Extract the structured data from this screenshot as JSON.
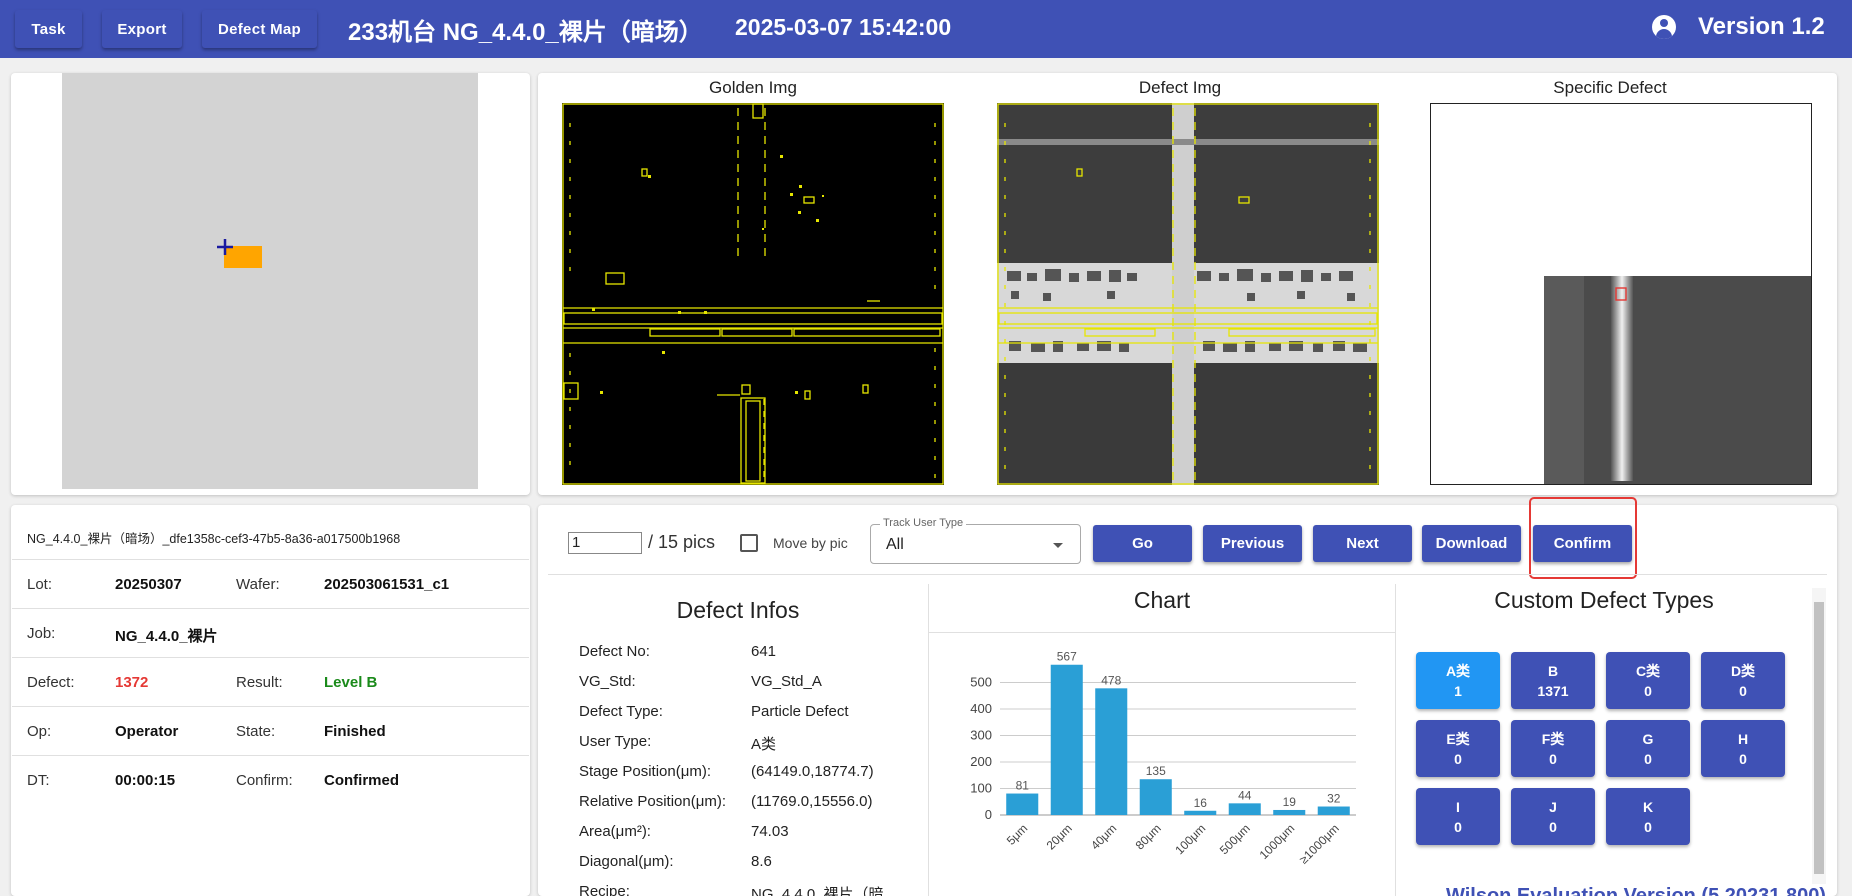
{
  "topbar": {
    "task_label": "Task",
    "export_label": "Export",
    "defect_map_label": "Defect Map",
    "title": "233机台   NG_4.4.0_裸片（暗场）",
    "datetime": "2025-03-07 15:42:00",
    "version": "Version 1.2"
  },
  "images": {
    "golden_title": "Golden Img",
    "defect_title": "Defect Img",
    "specific_title": "Specific Defect"
  },
  "info": {
    "header": "NG_4.4.0_裸片（暗场）_dfe1358c-cef3-47b5-8a36-a017500b1968",
    "lot_label": "Lot:",
    "lot_value": "20250307",
    "wafer_label": "Wafer:",
    "wafer_value": "202503061531_c1",
    "job_label": "Job:",
    "job_value": "NG_4.4.0_裸片",
    "defect_label": "Defect:",
    "defect_value": "1372",
    "result_label": "Result:",
    "result_value": "Level B",
    "op_label": "Op:",
    "op_value": "Operator",
    "state_label": "State:",
    "state_value": "Finished",
    "dt_label": "DT:",
    "dt_value": "00:00:15",
    "confirm_label": "Confirm:",
    "confirm_value": "Confirmed"
  },
  "controls": {
    "page_value": "1",
    "pics_label": "/ 15 pics",
    "move_by_pic_label": "Move by pic",
    "move_by_pic_checked": false,
    "track_user_type_label": "Track User Type",
    "track_user_type_value": "All",
    "go_label": "Go",
    "previous_label": "Previous",
    "next_label": "Next",
    "download_label": "Download",
    "confirm_label": "Confirm"
  },
  "defect_infos": {
    "title": "Defect Infos",
    "rows": [
      {
        "k": "Defect No:",
        "v": "641"
      },
      {
        "k": "VG_Std:",
        "v": "VG_Std_A"
      },
      {
        "k": "Defect Type:",
        "v": "Particle Defect"
      },
      {
        "k": "User Type:",
        "v": "A类"
      },
      {
        "k": "Stage Position(μm):",
        "v": "(64149.0,18774.7)"
      },
      {
        "k": "Relative Position(μm):",
        "v": "(11769.0,15556.0)"
      },
      {
        "k": "Area(μm²):",
        "v": "74.03"
      },
      {
        "k": "Diagonal(μm):",
        "v": "8.6"
      },
      {
        "k": "Recipe:",
        "v": "NG_4.4.0_裸片（暗"
      }
    ]
  },
  "chart_title": "Chart",
  "chart_data": {
    "type": "bar",
    "categories": [
      "5μm",
      "20μm",
      "40μm",
      "80μm",
      "100μm",
      "500μm",
      "1000μm",
      "≥1000μm"
    ],
    "values": [
      81,
      567,
      478,
      135,
      16,
      44,
      19,
      32
    ],
    "ylim": [
      0,
      600
    ],
    "yticks": [
      0,
      100,
      200,
      300,
      400,
      500
    ],
    "grid": true,
    "bar_color": "#2a9fd6"
  },
  "custom_defect_types": {
    "title": "Custom Defect Types",
    "items": [
      {
        "name": "A类",
        "count": "1",
        "active": true
      },
      {
        "name": "B",
        "count": "1371",
        "active": false
      },
      {
        "name": "C类",
        "count": "0",
        "active": false
      },
      {
        "name": "D类",
        "count": "0",
        "active": false
      },
      {
        "name": "E类",
        "count": "0",
        "active": false
      },
      {
        "name": "F类",
        "count": "0",
        "active": false
      },
      {
        "name": "G",
        "count": "0",
        "active": false
      },
      {
        "name": "H",
        "count": "0",
        "active": false
      },
      {
        "name": "I",
        "count": "0",
        "active": false
      },
      {
        "name": "J",
        "count": "0",
        "active": false
      },
      {
        "name": "K",
        "count": "0",
        "active": false
      }
    ]
  },
  "footer_text": "Wilson Evaluation Version (5.20231.800)",
  "colors": {
    "primary": "#3f51b5",
    "active_button": "#2196f3",
    "defect_count": "#e53935",
    "level_b": "#1a8a1a",
    "annotation_box": "#e6e600",
    "highlight": "#e53935"
  }
}
